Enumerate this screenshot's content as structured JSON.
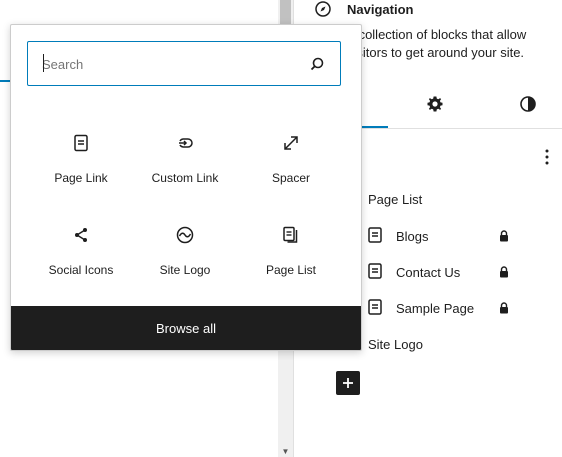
{
  "sidebar": {
    "title": "Navigation",
    "description": "A collection of blocks that allow visitors to get around your site.",
    "list": [
      {
        "label": "Page List"
      },
      {
        "label": "Blogs"
      },
      {
        "label": "Contact Us"
      },
      {
        "label": "Sample Page"
      },
      {
        "label": "Site Logo"
      }
    ]
  },
  "inserter": {
    "search_placeholder": "Search",
    "blocks": [
      {
        "label": "Page Link",
        "icon": "page-icon"
      },
      {
        "label": "Custom Link",
        "icon": "custom-link-icon"
      },
      {
        "label": "Spacer",
        "icon": "spacer-icon"
      },
      {
        "label": "Social Icons",
        "icon": "share-icon"
      },
      {
        "label": "Site Logo",
        "icon": "site-logo-icon"
      },
      {
        "label": "Page List",
        "icon": "page-list-icon"
      }
    ],
    "browse_all": "Browse all"
  },
  "colors": {
    "accent": "#007cba",
    "dark": "#1e1e1e"
  }
}
